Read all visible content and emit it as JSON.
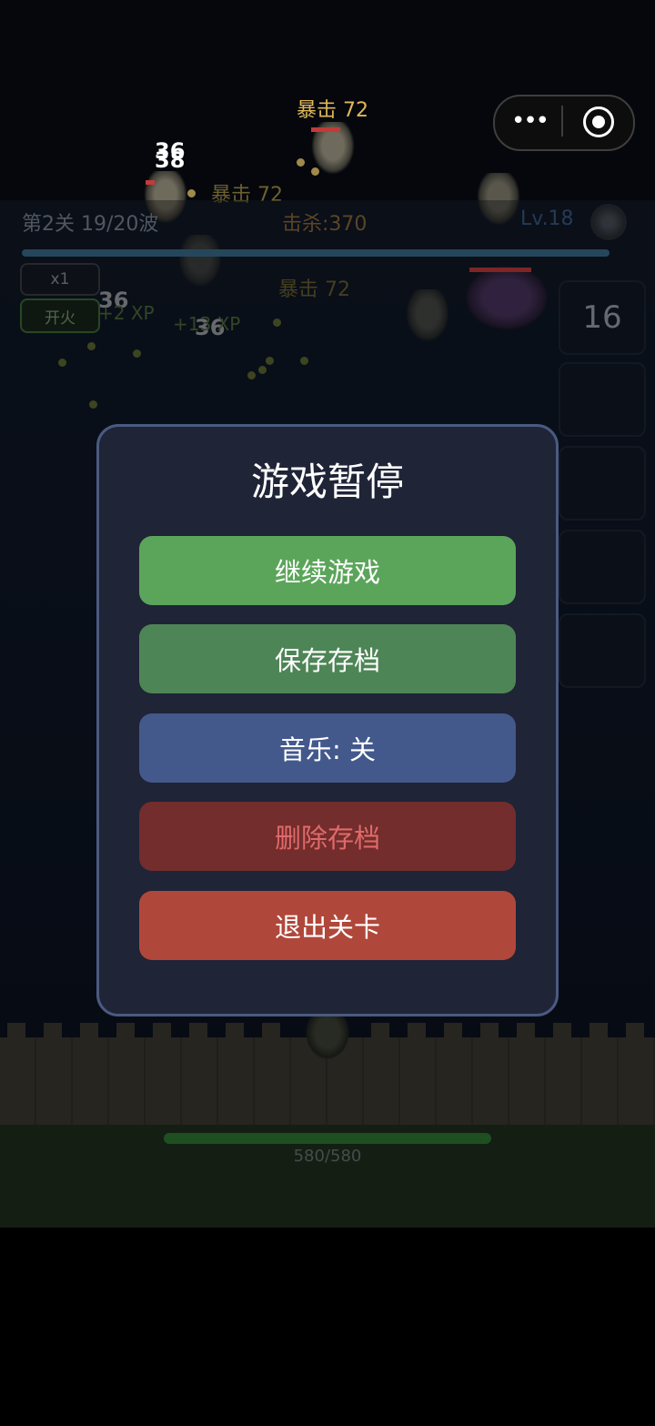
{
  "hud": {
    "level_wave": "第2关 19/20波",
    "kills": "击杀:370",
    "player_level": "Lv.18",
    "wave_progress": 0.97,
    "speed_label": "x1",
    "fire_label": "开火"
  },
  "weapon_slots": {
    "first_value": "16"
  },
  "floating_text": {
    "crit_top": "暴击 72",
    "crit_left": "暴击 72",
    "crit_mid": "暴击 72",
    "dmg_a": "36",
    "dmg_b": "38",
    "dmg_c": "36",
    "dmg_d": "36",
    "xp_a": "+2 XP",
    "xp_b": "+13 XP"
  },
  "castle": {
    "hp_text": "580/580",
    "hp_fraction": 1.0
  },
  "pause_menu": {
    "title": "游戏暂停",
    "resume": "继续游戏",
    "save": "保存存档",
    "music": "音乐: 关",
    "delete": "删除存档",
    "quit": "退出关卡"
  },
  "colors": {
    "resume": "#5ba55b",
    "save": "#4e8556",
    "music": "#43598c",
    "delete": "#722d2c",
    "delete_text": "#e06a6a",
    "quit": "#b0473b"
  },
  "icons": {
    "capsule_more": "more-dots-icon",
    "capsule_close": "target-circle-icon",
    "eye": "eye-icon"
  }
}
